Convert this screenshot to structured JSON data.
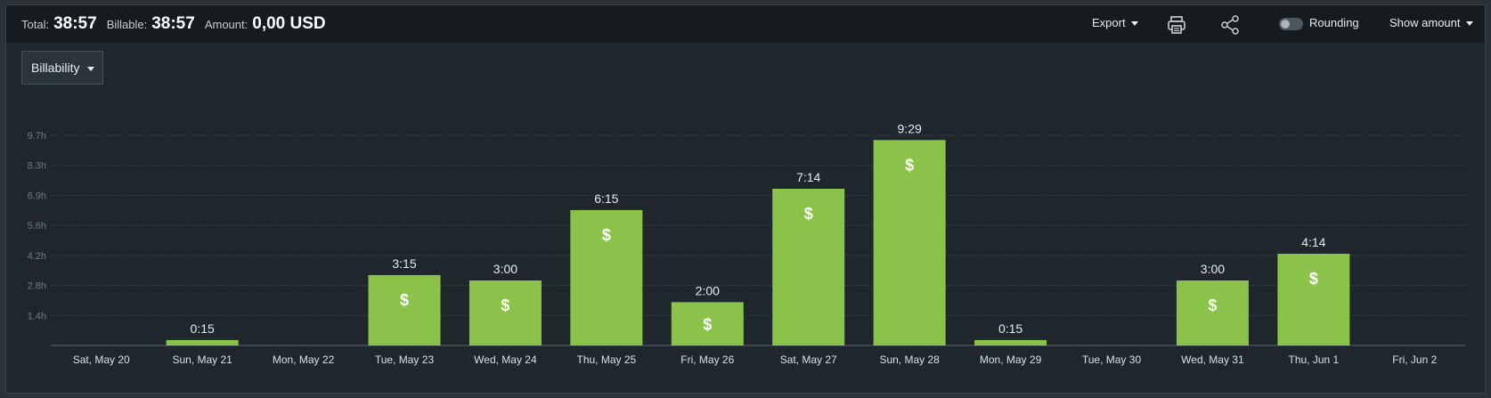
{
  "header": {
    "total_label": "Total:",
    "total_value": "38:57",
    "billable_label": "Billable:",
    "billable_value": "38:57",
    "amount_label": "Amount:",
    "amount_value": "0,00 USD",
    "export_label": "Export",
    "print_icon": "printer-icon",
    "share_icon": "share-icon",
    "rounding_label": "Rounding",
    "rounding_on": false,
    "show_amount_label": "Show amount"
  },
  "grouping": {
    "selected": "Billability"
  },
  "colors": {
    "bar": "#8bc34a",
    "background": "#1f272d",
    "topbar": "#151b1f",
    "grid": "#4b565d",
    "axis_text": "#6d7a83",
    "label_text": "#e6ebee"
  },
  "chart_data": {
    "type": "bar",
    "title": "",
    "xlabel": "",
    "ylabel": "",
    "ylim": [
      0,
      9.7
    ],
    "yticks": [
      "1.4h",
      "2.8h",
      "4.2h",
      "5.6h",
      "6.9h",
      "8.3h",
      "9.7h"
    ],
    "ytick_values": [
      1.386,
      2.771,
      4.157,
      5.543,
      6.929,
      8.314,
      9.7
    ],
    "grid": true,
    "legend": "none",
    "bar_icon": "$",
    "categories": [
      "Sat, May 20",
      "Sun, May 21",
      "Mon, May 22",
      "Tue, May 23",
      "Wed, May 24",
      "Thu, May 25",
      "Fri, May 26",
      "Sat, May 27",
      "Sun, May 28",
      "Mon, May 29",
      "Tue, May 30",
      "Wed, May 31",
      "Thu, Jun 1",
      "Fri, Jun 2"
    ],
    "values": [
      0,
      0.25,
      0,
      3.25,
      3.0,
      6.25,
      2.0,
      7.233,
      9.483,
      0.25,
      0,
      3.0,
      4.233,
      0
    ],
    "value_labels": [
      "",
      "0:15",
      "",
      "3:15",
      "3:00",
      "6:15",
      "2:00",
      "7:14",
      "9:29",
      "0:15",
      "",
      "3:00",
      "4:14",
      ""
    ]
  }
}
